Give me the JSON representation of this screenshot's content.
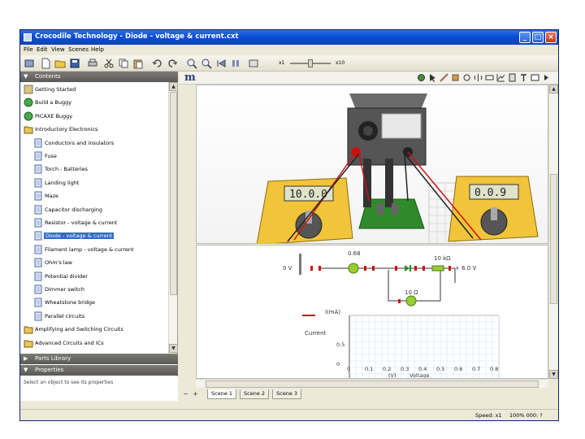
{
  "window": {
    "title": "Crocodile Technology - Diode - voltage & current.cxt"
  },
  "menu": [
    "File",
    "Edit",
    "View",
    "Scenes",
    "Help"
  ],
  "zoom": {
    "min_label": "x1",
    "max_label": "x10",
    "level_fraction": 0.45
  },
  "contents_panel": {
    "header": "Contents",
    "items": [
      {
        "label": "Getting Started",
        "icon": "page-icon",
        "level": 0
      },
      {
        "label": "Build a Buggy",
        "icon": "green-gear-icon",
        "level": 0
      },
      {
        "label": "PICAXE Buggy",
        "icon": "green-gear-icon",
        "level": 0
      },
      {
        "label": "Introductory Electronics",
        "icon": "circuit-folder-icon",
        "level": 0
      },
      {
        "label": "Conductors and insulators",
        "icon": "document-icon",
        "level": 1
      },
      {
        "label": "Fuse",
        "icon": "document-icon",
        "level": 1
      },
      {
        "label": "Torch - Batteries",
        "icon": "document-icon",
        "level": 1
      },
      {
        "label": "Landing light",
        "icon": "document-icon",
        "level": 1
      },
      {
        "label": "Maze",
        "icon": "document-icon",
        "level": 1
      },
      {
        "label": "Capacitor discharging",
        "icon": "document-icon",
        "level": 1
      },
      {
        "label": "Resistor - voltage & current",
        "icon": "document-icon",
        "level": 1
      },
      {
        "label": "Diode - voltage & current",
        "icon": "document-icon",
        "level": 1,
        "selected": true
      },
      {
        "label": "Filament lamp - voltage & current",
        "icon": "document-icon",
        "level": 1
      },
      {
        "label": "Ohm's law",
        "icon": "document-icon",
        "level": 1
      },
      {
        "label": "Potential divider",
        "icon": "document-icon",
        "level": 1
      },
      {
        "label": "Dimmer switch",
        "icon": "document-icon",
        "level": 1
      },
      {
        "label": "Wheatstone bridge",
        "icon": "document-icon",
        "level": 1
      },
      {
        "label": "Parallel circuits",
        "icon": "document-icon",
        "level": 1
      },
      {
        "label": "Amplifying and Switching Circuits",
        "icon": "circuit-folder-icon",
        "level": 0
      },
      {
        "label": "Advanced Circuits and ICs",
        "icon": "circuit-folder-icon",
        "level": 0
      }
    ]
  },
  "parts_library_header": "Parts Library",
  "properties_header": "Properties",
  "properties_text": "Select an object to see its properties",
  "schematic": {
    "voltage_left": "0 V",
    "voltage_right": "+ 6.0 V",
    "resistor_label": "10 kΩ",
    "lower_resistor_label": "10 Ω",
    "top_value": "0.68",
    "ammeter_label": "I(mA)",
    "graph": {
      "legend": "Current",
      "y_ticks": [
        "0.5",
        "0"
      ],
      "x_ticks": [
        "0",
        "0.1",
        "0.2",
        "0.3",
        "0.4",
        "0.5",
        "0.6",
        "0.7",
        "0.8"
      ],
      "x_axis_label": "(V)",
      "x_axis_select": "Voltage"
    }
  },
  "meters": {
    "left_display": "10.0.0",
    "right_display": "0.0.9"
  },
  "scene_tabs": [
    "Scene 1",
    "Scene 2",
    "Scene 3"
  ],
  "status": {
    "speed_label": "Speed: x1",
    "zoom_readout": "100%  000: ?"
  }
}
